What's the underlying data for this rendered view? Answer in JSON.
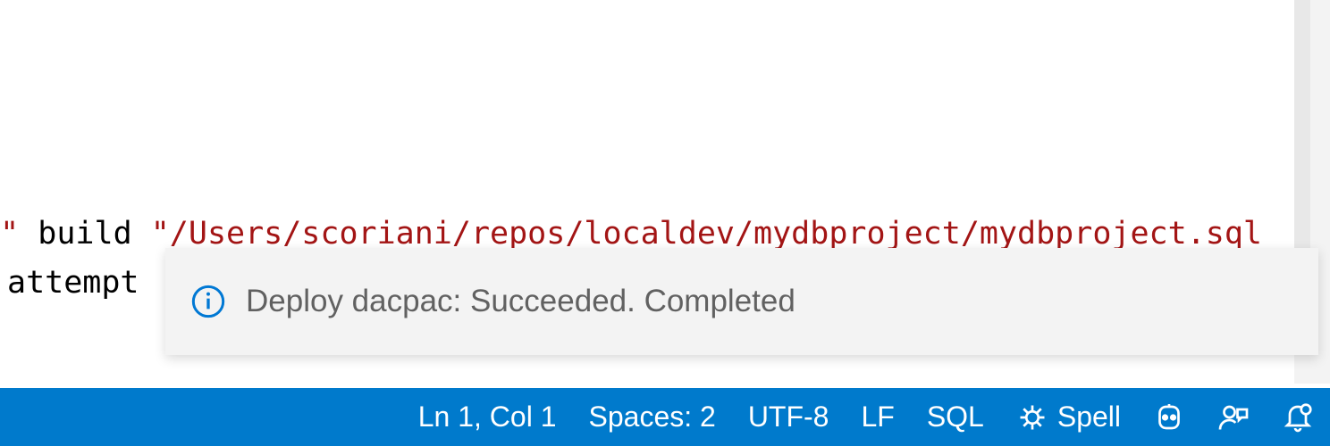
{
  "editor": {
    "line1_part1": "et\"",
    "line1_part2": "  build ",
    "line1_part3": "\"/Users/scoriani/repos/localdev/mydbproject/mydbproject.sql",
    "line2": " attempt"
  },
  "notification": {
    "message": "Deploy dacpac: Succeeded. Completed"
  },
  "statusbar": {
    "cursor": "Ln 1, Col 1",
    "indent": "Spaces: 2",
    "encoding": "UTF-8",
    "eol": "LF",
    "language": "SQL",
    "spell": "Spell"
  }
}
